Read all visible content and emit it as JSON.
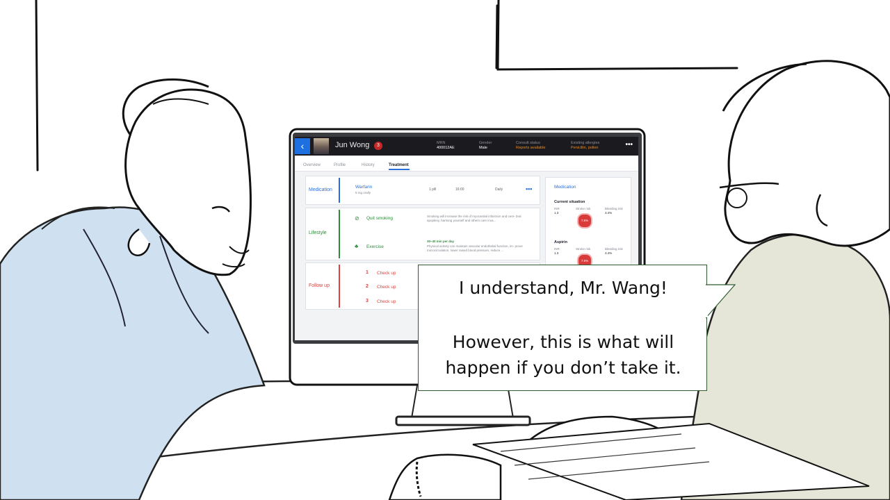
{
  "patient": {
    "name": "Jun Wong",
    "alert_count": "3",
    "mrn_label": "MRN",
    "mrn_value": "400012AE",
    "gender_label": "Gender",
    "gender_value": "Male",
    "consult_label": "Consult status",
    "consult_value": "Reports available",
    "allergies_label": "Existing allergies",
    "allergies_value": "Penicillin, pollen",
    "more": "•••"
  },
  "tabs": [
    "Overview",
    "Profile",
    "History",
    "Treatment"
  ],
  "treatment": {
    "medication_label": "Medication",
    "drug_name": "Warfarin",
    "drug_dose": "5 mg orally",
    "drug_qty": "1 pill",
    "drug_time": "16:00",
    "drug_freq": "Daily",
    "drug_more": "•••",
    "lifestyle_label": "Lifestyle",
    "quit_smoking_label": "Quit smoking",
    "quit_smoking_text": "Smoking will increase the risk of myocardial infarction and cere- bral apoplexy, harming yourself and others care inva...",
    "exercise_target": "30–40 min per day",
    "exercise_label": "Exercise",
    "exercise_text": "Physical activity can maintain vascular endothelial function, im- prove microcirculation, lower raised blood pressure, reduce ...",
    "followup_label": "Follow up",
    "followups": [
      {
        "num": "1",
        "label": "Check up"
      },
      {
        "num": "2",
        "label": "Check up"
      },
      {
        "num": "3",
        "label": "Check up"
      }
    ]
  },
  "side_panel": {
    "title": "Medication",
    "current_title": "Current situation",
    "inr_label": "INR",
    "inr_value": "1.3",
    "stroke_label": "Stroke risk",
    "bleeding_label": "Bleeding risk",
    "bleeding_value": "3.4%",
    "risk_circle_value": "7.5%",
    "aspirin_title": "Aspirin",
    "aspirin_inr_value": "1.3",
    "aspirin_bleeding_value": "3.4%"
  },
  "speech_bubble": {
    "line1": "I understand, Mr. Wang!",
    "line2": "However, this is what will",
    "line3": "happen if you don’t take it."
  },
  "colors": {
    "header_bg": "#1b1b1f",
    "accent_blue": "#2a6fdb",
    "lifestyle_green": "#2e8b3c",
    "followup_red": "#d8423b",
    "warning_orange": "#f08a1c",
    "patient_shirt": "#cfe1f0",
    "doctor_garment": "#e6e6d8",
    "bubble_border": "#2f5a2f"
  }
}
